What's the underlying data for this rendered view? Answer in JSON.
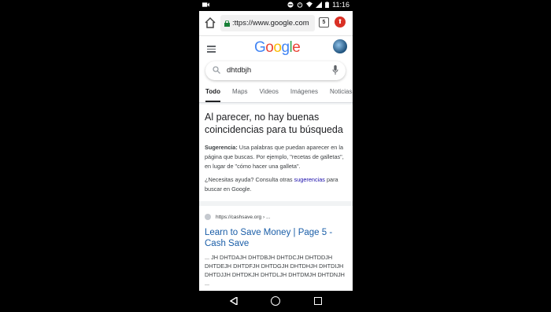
{
  "status_bar": {
    "time": "11:16",
    "icons": [
      "video-icon",
      "dnd-icon",
      "alarm-icon",
      "wifi-icon",
      "signal-icon",
      "battery-icon"
    ]
  },
  "browser": {
    "url": ":ttps://www.google.com",
    "tabs_count": "5"
  },
  "google": {
    "logo": "Google",
    "search_query": "dhtdbjh",
    "tabs": [
      "Todo",
      "Maps",
      "Videos",
      "Imágenes",
      "Noticias"
    ],
    "active_tab": "Todo",
    "logo_colors": [
      "#4285F4",
      "#EA4335",
      "#FBBC05",
      "#4285F4",
      "#34A853",
      "#EA4335"
    ]
  },
  "no_results": {
    "heading": "Al parecer, no hay buenas coincidencias para tu búsqueda",
    "suggestion_label": "Sugerencia:",
    "suggestion_text": " Usa palabras que puedan aparecer en la página que buscas. Por ejemplo, \"recetas de galletas\", en lugar de \"cómo hacer una galleta\".",
    "help_prefix": "¿Necesitas ayuda? Consulta otras ",
    "help_link": "sugerencias",
    "help_suffix": " para buscar en Google."
  },
  "result": {
    "site": "https://cashsave.org › ...",
    "title": "Learn to Save Money | Page 5 - Cash Save",
    "snippet": "... JH DHTDAJH DHTDBJH DHTDCJH DHTDDJH DHTDEJH DHTDFJH DHTDGJH DHTDHJH DHTDIJH DHTDJJH DHTDKJH DHTDLJH DHTDMJH DHTDNJH ..."
  }
}
